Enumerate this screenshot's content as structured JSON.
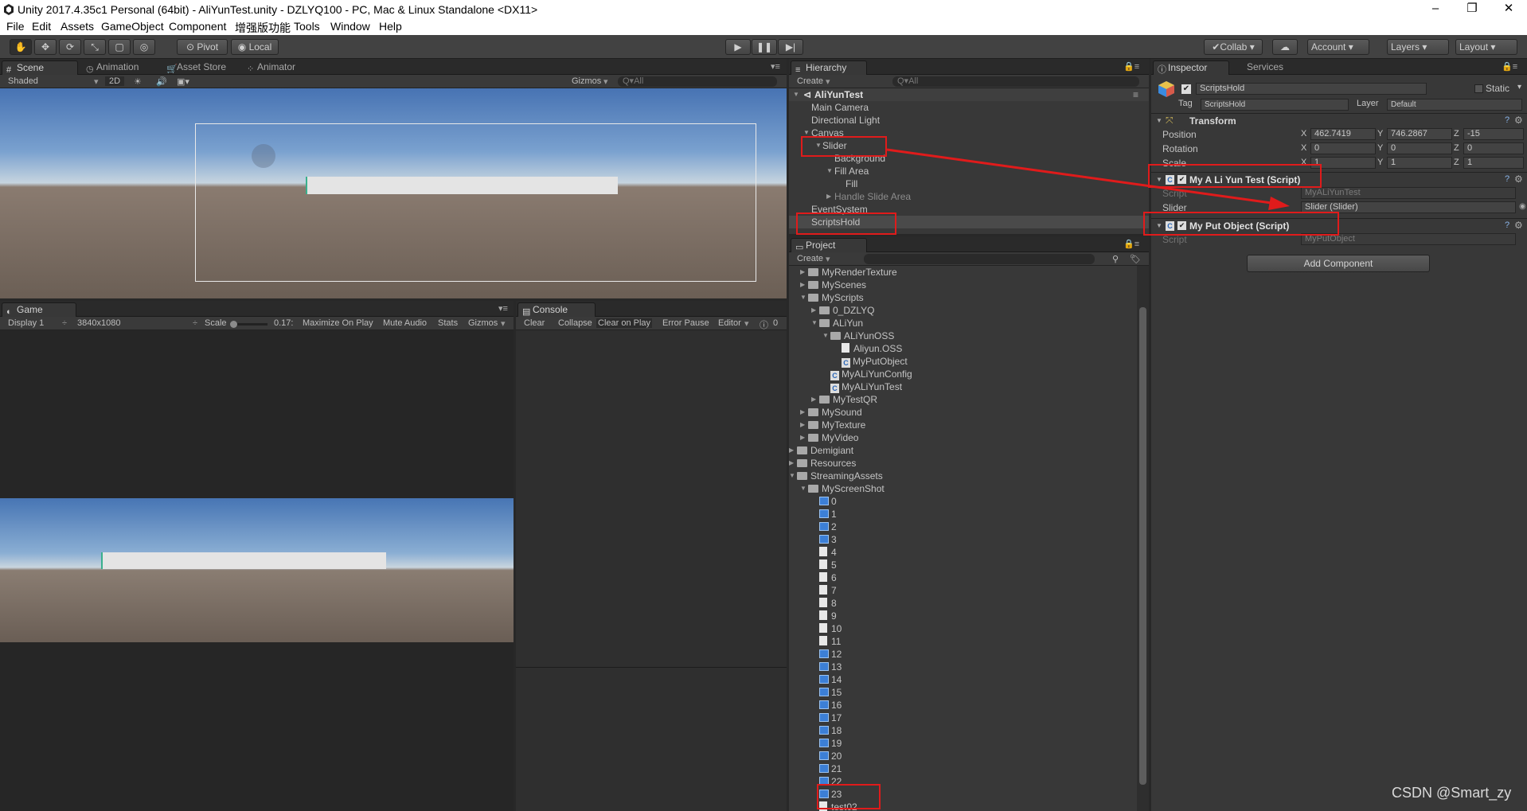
{
  "window": {
    "title": "Unity 2017.4.35c1 Personal (64bit) - AliYunTest.unity - DZLYQ100 - PC, Mac & Linux Standalone <DX11>",
    "minimize": "–",
    "restore": "❐",
    "close": "✕"
  },
  "menu": [
    "File",
    "Edit",
    "Assets",
    "GameObject",
    "Component",
    "增强版功能",
    "Tools",
    "Window",
    "Help"
  ],
  "toolbar": {
    "pivot": "Pivot",
    "local": "Local",
    "collab": "Collab",
    "account": "Account",
    "layers": "Layers",
    "layout": "Layout"
  },
  "scene": {
    "tabs": [
      "Scene",
      "Animation",
      "Asset Store",
      "Animator"
    ],
    "shading": "Shaded",
    "mode2d": "2D",
    "gizmos": "Gizmos",
    "search_placeholder": "Q▾All"
  },
  "game": {
    "tab": "Game",
    "display": "Display 1",
    "resolution": "3840x1080",
    "scale_label": "Scale",
    "scale_value": "0.17:",
    "buttons": [
      "Maximize On Play",
      "Mute Audio",
      "Stats",
      "Gizmos"
    ]
  },
  "console": {
    "tab": "Console",
    "buttons": [
      "Clear",
      "Collapse",
      "Clear on Play",
      "Error Pause",
      "Editor"
    ],
    "count": "0"
  },
  "hierarchy": {
    "tab": "Hierarchy",
    "create": "Create",
    "search_placeholder": "Q▾All",
    "scene_name": "AliYunTest",
    "items": [
      {
        "label": "Main Camera",
        "level": 1
      },
      {
        "label": "Directional Light",
        "level": 1
      },
      {
        "label": "Canvas",
        "level": 1
      },
      {
        "label": "Slider",
        "level": 2
      },
      {
        "label": "Background",
        "level": 3
      },
      {
        "label": "Fill Area",
        "level": 3
      },
      {
        "label": "Fill",
        "level": 4
      },
      {
        "label": "Handle Slide Area",
        "level": 3
      },
      {
        "label": "EventSystem",
        "level": 1
      },
      {
        "label": "ScriptsHold",
        "level": 1
      }
    ]
  },
  "project": {
    "tab": "Project",
    "create": "Create",
    "items": [
      {
        "label": "MyRenderTexture",
        "kind": "folder",
        "level": 1
      },
      {
        "label": "MyScenes",
        "kind": "folder",
        "level": 1
      },
      {
        "label": "MyScripts",
        "kind": "folder",
        "level": 1
      },
      {
        "label": "0_DZLYQ",
        "kind": "folder",
        "level": 2
      },
      {
        "label": "ALiYun",
        "kind": "folder",
        "level": 2
      },
      {
        "label": "ALiYunOSS",
        "kind": "folder",
        "level": 3
      },
      {
        "label": "Aliyun.OSS",
        "kind": "doc",
        "level": 4
      },
      {
        "label": "MyPutObject",
        "kind": "script",
        "level": 4
      },
      {
        "label": "MyALiYunConfig",
        "kind": "script",
        "level": 3
      },
      {
        "label": "MyALiYunTest",
        "kind": "script",
        "level": 3
      },
      {
        "label": "MyTestQR",
        "kind": "folder",
        "level": 2
      },
      {
        "label": "MySound",
        "kind": "folder",
        "level": 1
      },
      {
        "label": "MyTexture",
        "kind": "folder",
        "level": 1
      },
      {
        "label": "MyVideo",
        "kind": "folder",
        "level": 1
      },
      {
        "label": "Demigiant",
        "kind": "folder",
        "level": 0
      },
      {
        "label": "Resources",
        "kind": "folder",
        "level": 0
      },
      {
        "label": "StreamingAssets",
        "kind": "folder",
        "level": 0
      },
      {
        "label": "MyScreenShot",
        "kind": "folder",
        "level": 1
      },
      {
        "label": "0",
        "kind": "img",
        "level": 2
      },
      {
        "label": "1",
        "kind": "img",
        "level": 2
      },
      {
        "label": "2",
        "kind": "img",
        "level": 2
      },
      {
        "label": "3",
        "kind": "img",
        "level": 2
      },
      {
        "label": "4",
        "kind": "doc",
        "level": 2
      },
      {
        "label": "5",
        "kind": "doc",
        "level": 2
      },
      {
        "label": "6",
        "kind": "doc",
        "level": 2
      },
      {
        "label": "7",
        "kind": "doc",
        "level": 2
      },
      {
        "label": "8",
        "kind": "doc",
        "level": 2
      },
      {
        "label": "9",
        "kind": "doc",
        "level": 2
      },
      {
        "label": "10",
        "kind": "doc",
        "level": 2
      },
      {
        "label": "11",
        "kind": "doc",
        "level": 2
      },
      {
        "label": "12",
        "kind": "img",
        "level": 2
      },
      {
        "label": "13",
        "kind": "img",
        "level": 2
      },
      {
        "label": "14",
        "kind": "img",
        "level": 2
      },
      {
        "label": "15",
        "kind": "img",
        "level": 2
      },
      {
        "label": "16",
        "kind": "img",
        "level": 2
      },
      {
        "label": "17",
        "kind": "img",
        "level": 2
      },
      {
        "label": "18",
        "kind": "img",
        "level": 2
      },
      {
        "label": "19",
        "kind": "img",
        "level": 2
      },
      {
        "label": "20",
        "kind": "img",
        "level": 2
      },
      {
        "label": "21",
        "kind": "img",
        "level": 2
      },
      {
        "label": "22",
        "kind": "img",
        "level": 2
      },
      {
        "label": "23",
        "kind": "img",
        "level": 2
      },
      {
        "label": "test02",
        "kind": "doc",
        "level": 2
      }
    ]
  },
  "inspector": {
    "tabs": [
      "Inspector",
      "Services"
    ],
    "object_name": "ScriptsHold",
    "static_label": "Static",
    "tag_label": "Tag",
    "tag_value": "ScriptsHold",
    "layer_label": "Layer",
    "layer_value": "Default",
    "transform": {
      "title": "Transform",
      "position_label": "Position",
      "rotation_label": "Rotation",
      "scale_label": "Scale",
      "position": {
        "x": "462.7419",
        "y": "746.2867",
        "z": "-15"
      },
      "rotation": {
        "x": "0",
        "y": "0",
        "z": "0"
      },
      "scale": {
        "x": "1",
        "y": "1",
        "z": "1"
      }
    },
    "comp1": {
      "title": "My A Li Yun Test (Script)",
      "script_label": "Script",
      "script_value": "MyALiYunTest",
      "slider_label": "Slider",
      "slider_value": "Slider (Slider)"
    },
    "comp2": {
      "title": "My Put Object (Script)",
      "script_label": "Script",
      "script_value": "MyPutObject"
    },
    "add_component": "Add Component"
  },
  "watermark": "CSDN @Smart_zy",
  "colors": {
    "highlight": "#e01b1b",
    "panel": "#383838",
    "sky": "#4f79b8",
    "ground": "#6b5f55"
  }
}
